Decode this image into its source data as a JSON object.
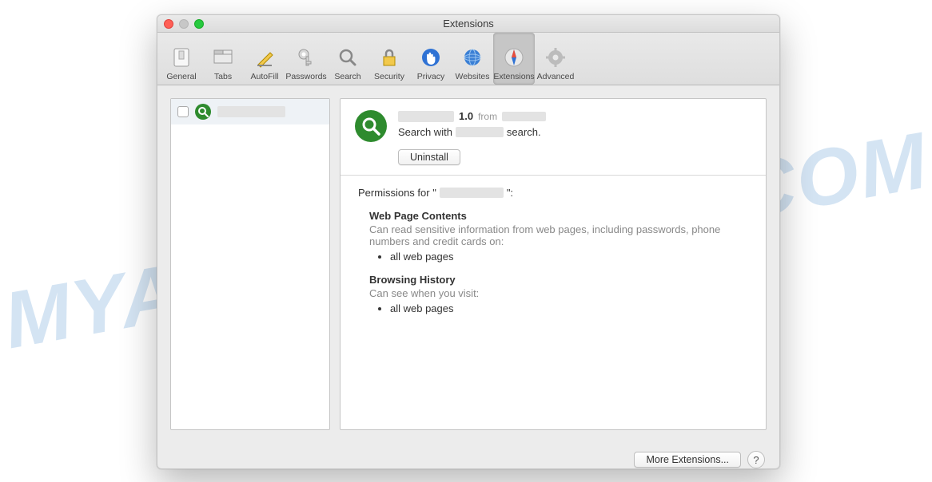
{
  "watermark": "MYANTISPYWARE.COM",
  "window": {
    "title": "Extensions"
  },
  "toolbar": {
    "items": [
      {
        "label": "General"
      },
      {
        "label": "Tabs"
      },
      {
        "label": "AutoFill"
      },
      {
        "label": "Passwords"
      },
      {
        "label": "Search"
      },
      {
        "label": "Security"
      },
      {
        "label": "Privacy"
      },
      {
        "label": "Websites"
      },
      {
        "label": "Extensions"
      },
      {
        "label": "Advanced"
      }
    ],
    "selected_index": 8
  },
  "sidebar": {
    "items": [
      {
        "name_redacted": true,
        "checked": false
      }
    ]
  },
  "detail": {
    "name_redacted": true,
    "version": "1.0",
    "from_label": "from",
    "from_redacted": true,
    "desc_prefix": "Search with",
    "desc_middle_redacted": true,
    "desc_suffix": "search.",
    "uninstall_label": "Uninstall"
  },
  "permissions": {
    "title_prefix": "Permissions for \"",
    "name_redacted": true,
    "title_suffix": "\":",
    "sections": [
      {
        "heading": "Web Page Contents",
        "sub": "Can read sensitive information from web pages, including passwords, phone numbers and credit cards on:",
        "items": [
          "all web pages"
        ]
      },
      {
        "heading": "Browsing History",
        "sub": "Can see when you visit:",
        "items": [
          "all web pages"
        ]
      }
    ]
  },
  "footer": {
    "more_label": "More Extensions...",
    "help_label": "?"
  }
}
